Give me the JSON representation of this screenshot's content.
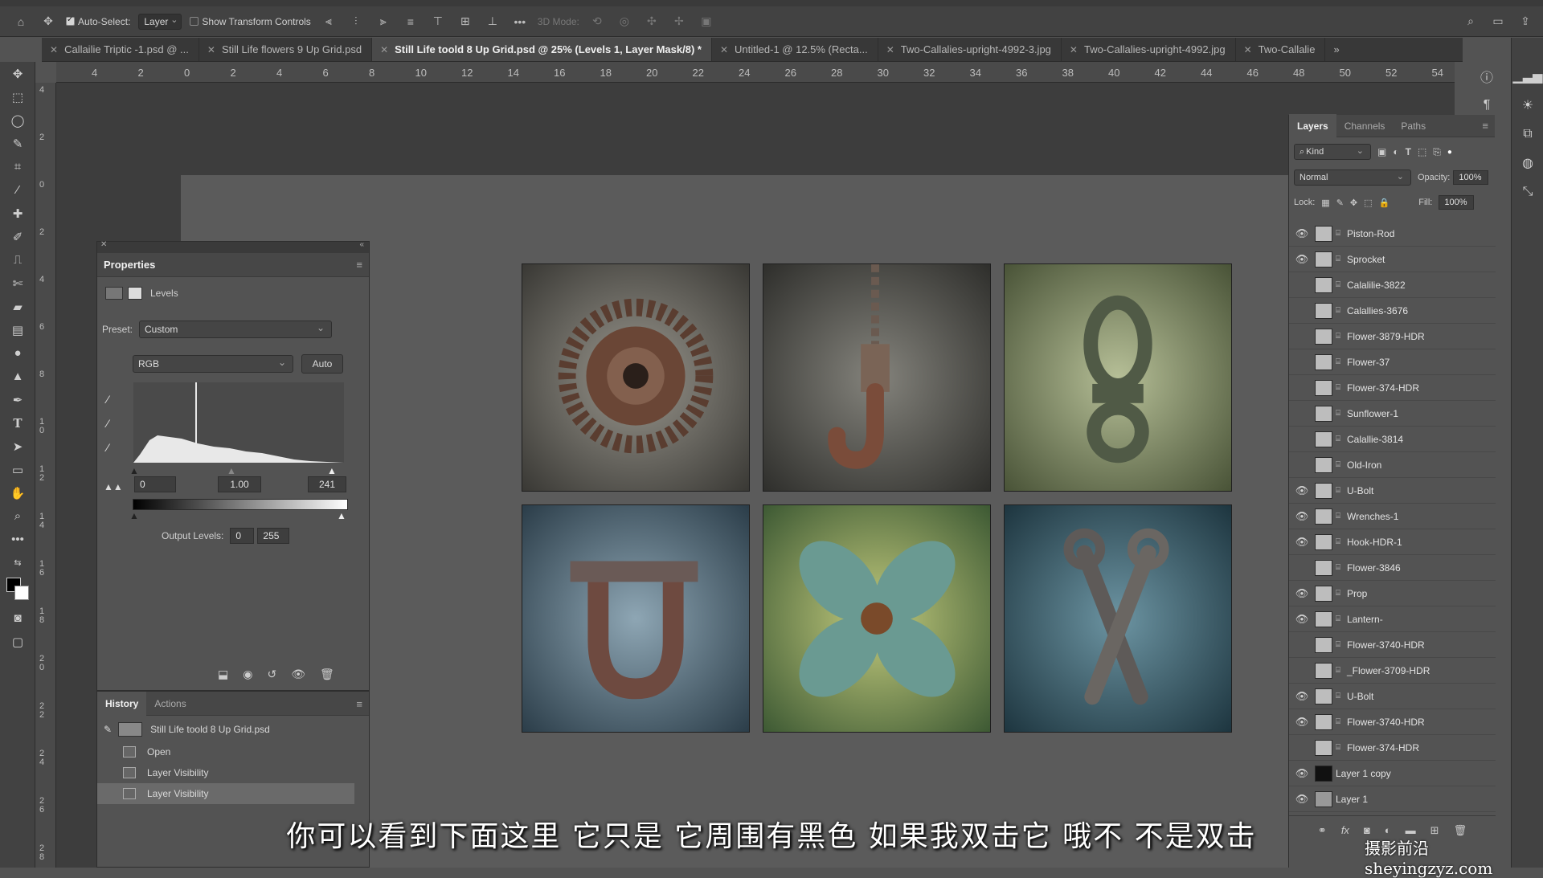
{
  "options_bar": {
    "auto_select_label": "Auto-Select:",
    "auto_select_value": "Layer",
    "transform_label": "Show Transform Controls",
    "mode_3d_label": "3D Mode:"
  },
  "tabs": [
    {
      "label": "Callailie Triptic -1.psd @ ..."
    },
    {
      "label": "Still Life flowers 9 Up Grid.psd"
    },
    {
      "label": "Still Life toold 8 Up Grid.psd @ 25% (Levels 1, Layer Mask/8) *"
    },
    {
      "label": "Untitled-1 @ 12.5% (Recta..."
    },
    {
      "label": "Two-Callalies-upright-4992-3.jpg"
    },
    {
      "label": "Two-Callalies-upright-4992.jpg"
    },
    {
      "label": "Two-Callalie"
    }
  ],
  "ruler_top": [
    "4",
    "2",
    "0",
    "2",
    "4",
    "6",
    "8",
    "10",
    "12",
    "14",
    "16",
    "18",
    "20",
    "22",
    "24",
    "26",
    "28",
    "30",
    "32",
    "34",
    "36",
    "38",
    "40",
    "42",
    "44",
    "46",
    "48",
    "50",
    "52",
    "54"
  ],
  "ruler_left": [
    "4",
    "2",
    "0",
    "2",
    "4",
    "6",
    "8",
    "1 0",
    "1 2",
    "1 4",
    "1 6",
    "1 8",
    "2 0",
    "2 2",
    "2 4",
    "2 6",
    "2 8"
  ],
  "properties": {
    "title": "Properties",
    "adjustment_name": "Levels",
    "preset_label": "Preset:",
    "preset_value": "Custom",
    "channel_value": "RGB",
    "auto_label": "Auto",
    "input_black": "0",
    "input_gamma": "1.00",
    "input_white": "241",
    "output_label": "Output Levels:",
    "output_black": "0",
    "output_white": "255"
  },
  "history": {
    "tab_history": "History",
    "tab_actions": "Actions",
    "snapshot": "Still Life toold 8 Up Grid.psd",
    "items": [
      "Open",
      "Layer Visibility",
      "Layer Visibility"
    ]
  },
  "layers_panel": {
    "tab_layers": "Layers",
    "tab_channels": "Channels",
    "tab_paths": "Paths",
    "kind_label": "Kind",
    "blend_mode": "Normal",
    "opacity_label": "Opacity:",
    "opacity_value": "100%",
    "lock_label": "Lock:",
    "fill_label": "Fill:",
    "fill_value": "100%",
    "layers": [
      {
        "name": "Piston-Rod",
        "visible": true
      },
      {
        "name": "Sprocket",
        "visible": true
      },
      {
        "name": "Calalilie-3822",
        "visible": false
      },
      {
        "name": "Calallies-3676",
        "visible": false
      },
      {
        "name": "Flower-3879-HDR",
        "visible": false
      },
      {
        "name": "Flower-37",
        "visible": false
      },
      {
        "name": "Flower-374-HDR",
        "visible": false
      },
      {
        "name": "Sunflower-1",
        "visible": false
      },
      {
        "name": "Calallie-3814",
        "visible": false
      },
      {
        "name": "Old-Iron",
        "visible": false
      },
      {
        "name": "U-Bolt",
        "visible": true
      },
      {
        "name": "Wrenches-1",
        "visible": true
      },
      {
        "name": "Hook-HDR-1",
        "visible": true
      },
      {
        "name": "Flower-3846",
        "visible": false
      },
      {
        "name": "Prop",
        "visible": true
      },
      {
        "name": "Lantern-",
        "visible": true
      },
      {
        "name": "Flower-3740-HDR",
        "visible": false
      },
      {
        "name": "_Flower-3709-HDR",
        "visible": false
      },
      {
        "name": "U-Bolt",
        "visible": true
      },
      {
        "name": "Flower-3740-HDR",
        "visible": true
      },
      {
        "name": "Flower-374-HDR",
        "visible": false
      },
      {
        "name": "Layer 1 copy",
        "visible": true
      },
      {
        "name": "Layer 1",
        "visible": true
      }
    ]
  },
  "subtitle": "你可以看到下面这里 它只是 它周围有黑色 如果我双击它 哦不 不是双击",
  "watermark": "摄影前沿sheyingzyz.com"
}
